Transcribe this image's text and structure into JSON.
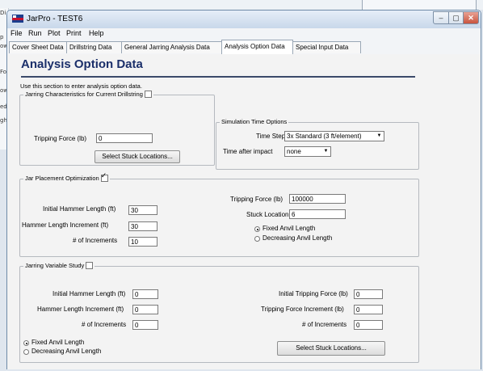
{
  "background": {
    "left_fragments": [
      "Di",
      "p",
      "ow",
      "For",
      "ow",
      "ed",
      "gh"
    ]
  },
  "window": {
    "title": "JarPro - TEST6",
    "controls": {
      "minimize": "–",
      "maximize": "▢",
      "close": "✕"
    }
  },
  "menu": [
    "File",
    "Run",
    "Plot",
    "Print",
    "Help"
  ],
  "tabs": [
    {
      "label": "Cover Sheet Data",
      "active": false
    },
    {
      "label": "Drillstring Data",
      "active": false
    },
    {
      "label": "General Jarring Analysis Data",
      "active": false
    },
    {
      "label": "Analysis Option Data",
      "active": true
    },
    {
      "label": "Special Input Data",
      "active": false
    }
  ],
  "page": {
    "title": "Analysis Option Data",
    "intro": "Use this section to enter analysis option data.",
    "title_color": "#1b2f6a"
  },
  "jarring_characteristics": {
    "legend": "Jarring Characteristics for Current Drillstring",
    "checked": false,
    "tripping_force_label": "Tripping Force (lb)",
    "tripping_force_value": "0",
    "button": "Select Stuck Locations..."
  },
  "simulation_time": {
    "legend": "Simulation Time Options",
    "time_step_label": "Time Step",
    "time_step_value": "3x Standard (3 ft/element)",
    "time_after_label": "Time after impact",
    "time_after_value": "none"
  },
  "jar_placement": {
    "legend": "Jar Placement Optimization",
    "checked": true,
    "initial_label": "Initial Hammer Length (ft)",
    "initial_value": "30",
    "increment_label": "Hammer Length Increment (ft)",
    "increment_value": "30",
    "num_label": "# of Increments",
    "num_value": "10",
    "tripping_label": "Tripping Force (lb)",
    "tripping_value": "100000",
    "stuck_label": "Stuck Location",
    "stuck_value": "6",
    "radio_fixed": "Fixed Anvil Length",
    "radio_decreasing": "Decreasing Anvil Length",
    "selected": "fixed"
  },
  "jarring_variable": {
    "legend": "Jarring Variable Study",
    "checked": false,
    "initial_label": "Initial Hammer Length (ft)",
    "initial_value": "0",
    "increment_label": "Hammer Length Increment (ft)",
    "increment_value": "0",
    "num_label": "# of Increments",
    "num_value": "0",
    "init_trip_label": "Initial Tripping Force (lb)",
    "init_trip_value": "0",
    "trip_inc_label": "Tripping Force Increment (lb)",
    "trip_inc_value": "0",
    "num2_label": "# of Increments",
    "num2_value": "0",
    "radio_fixed": "Fixed Anvil Length",
    "radio_decreasing": "Decreasing Anvil Length",
    "selected": "fixed",
    "button": "Select Stuck Locations..."
  }
}
